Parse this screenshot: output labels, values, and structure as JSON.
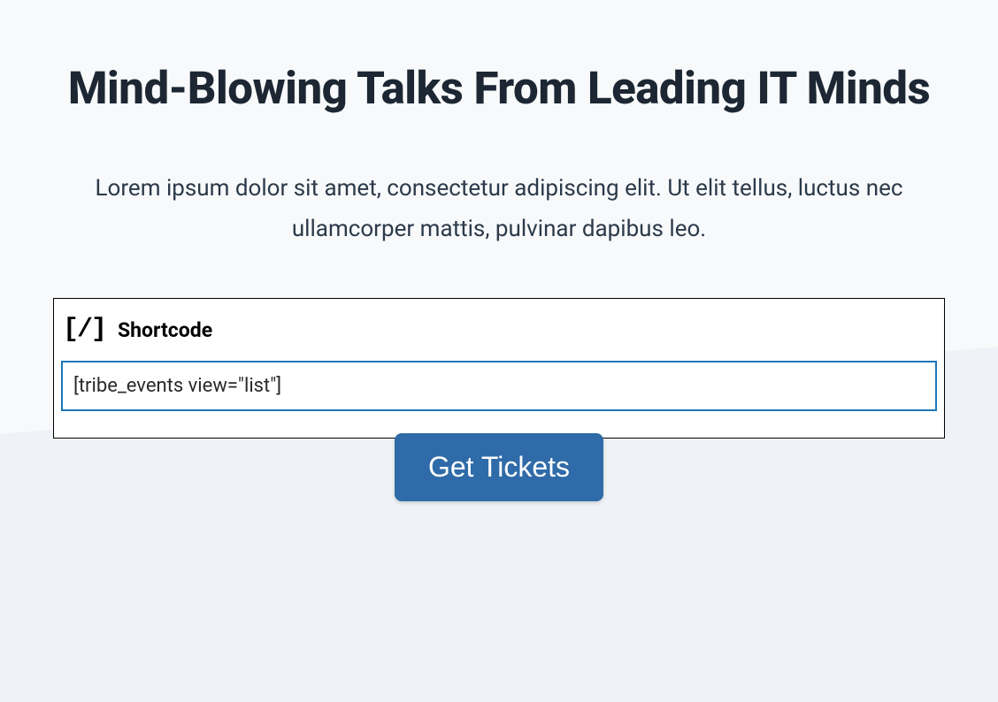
{
  "heading": "Mind-Blowing Talks From Leading IT Minds",
  "description": "Lorem ipsum dolor sit amet, consectetur adipiscing elit. Ut elit tellus, luctus nec ullamcorper mattis, pulvinar dapibus leo.",
  "widget": {
    "icon_glyph": "[/]",
    "title": "Shortcode",
    "input_value": "[tribe_events view=\"list\"]"
  },
  "cta": {
    "label": "Get Tickets"
  },
  "colors": {
    "heading": "#1c2733",
    "body_text": "#2b3a4a",
    "input_border": "#1b77b8",
    "button_bg": "#2f6ba8",
    "button_text": "#ffffff"
  }
}
